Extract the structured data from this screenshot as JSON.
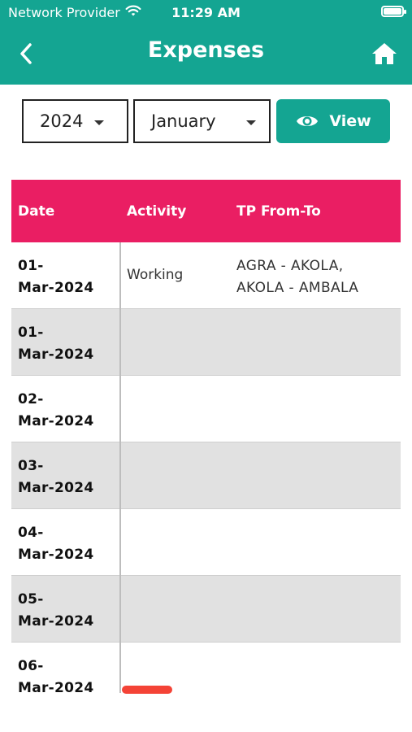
{
  "status_bar": {
    "carrier": "Network Provider",
    "time": "11:29 AM"
  },
  "header": {
    "title": "Expenses"
  },
  "filters": {
    "year": "2024",
    "month": "January",
    "view_label": "View"
  },
  "table": {
    "headers": [
      "Date",
      "Activity",
      "TP From-To"
    ],
    "rows": [
      {
        "date_day": "01-",
        "date_rest": "Mar-2024",
        "activity": "Working",
        "tp_line1": "AGRA  - AKOLA,",
        "tp_line2": "AKOLA - AMBALA"
      },
      {
        "date_day": "01-",
        "date_rest": "Mar-2024",
        "activity": "",
        "tp_line1": "",
        "tp_line2": ""
      },
      {
        "date_day": "02-",
        "date_rest": "Mar-2024",
        "activity": "",
        "tp_line1": "",
        "tp_line2": ""
      },
      {
        "date_day": "03-",
        "date_rest": "Mar-2024",
        "activity": "",
        "tp_line1": "",
        "tp_line2": ""
      },
      {
        "date_day": "04-",
        "date_rest": "Mar-2024",
        "activity": "",
        "tp_line1": "",
        "tp_line2": ""
      },
      {
        "date_day": "05-",
        "date_rest": "Mar-2024",
        "activity": "",
        "tp_line1": "",
        "tp_line2": ""
      },
      {
        "date_day": "06-",
        "date_rest": "Mar-2024",
        "activity": "",
        "tp_line1": "",
        "tp_line2": ""
      }
    ]
  },
  "colors": {
    "primary": "#14a592",
    "header_row": "#ea1e63",
    "alt_row": "#e1e1e1",
    "indicator": "#f44336"
  },
  "icons": {
    "back": "chevron-left-icon",
    "home": "home-icon",
    "view": "eye-icon",
    "wifi": "wifi-icon",
    "battery": "battery-icon"
  }
}
